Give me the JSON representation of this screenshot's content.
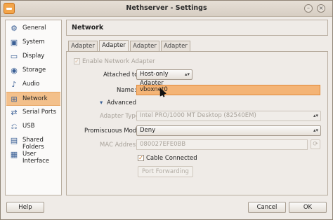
{
  "window": {
    "title": "Nethserver - Settings"
  },
  "sidebar": {
    "items": [
      {
        "label": "General",
        "icon": "general-icon"
      },
      {
        "label": "System",
        "icon": "system-icon"
      },
      {
        "label": "Display",
        "icon": "display-icon"
      },
      {
        "label": "Storage",
        "icon": "storage-icon"
      },
      {
        "label": "Audio",
        "icon": "audio-icon"
      },
      {
        "label": "Network",
        "icon": "network-icon",
        "active": true
      },
      {
        "label": "Serial Ports",
        "icon": "serial-ports-icon"
      },
      {
        "label": "USB",
        "icon": "usb-icon"
      },
      {
        "label": "Shared Folders",
        "icon": "shared-folders-icon"
      },
      {
        "label": "User Interface",
        "icon": "user-interface-icon"
      }
    ]
  },
  "content": {
    "header": "Network",
    "tabs": [
      "Adapter 1",
      "Adapter 2",
      "Adapter 3",
      "Adapter 4"
    ],
    "active_tab": "Adapter 2",
    "enable_adapter_label": "Enable Network Adapter",
    "attached_to_label": "Attached to:",
    "attached_to_value": "Host-only Adapter",
    "name_label": "Name:",
    "name_value": "vboxnet0",
    "advanced_label": "Advanced",
    "adapter_type_label": "Adapter Type:",
    "adapter_type_value": "Intel PRO/1000 MT Desktop (82540EM)",
    "promiscuous_label": "Promiscuous Mode:",
    "promiscuous_value": "Deny",
    "mac_label": "MAC Address:",
    "mac_value": "080027EFE0BB",
    "cable_connected_label": "Cable Connected",
    "port_forwarding_label": "Port Forwarding"
  },
  "footer": {
    "help_label": "Help",
    "cancel_label": "Cancel",
    "ok_label": "OK"
  },
  "colors": {
    "accent": "#f3c08b",
    "focus": "#f4b476"
  }
}
